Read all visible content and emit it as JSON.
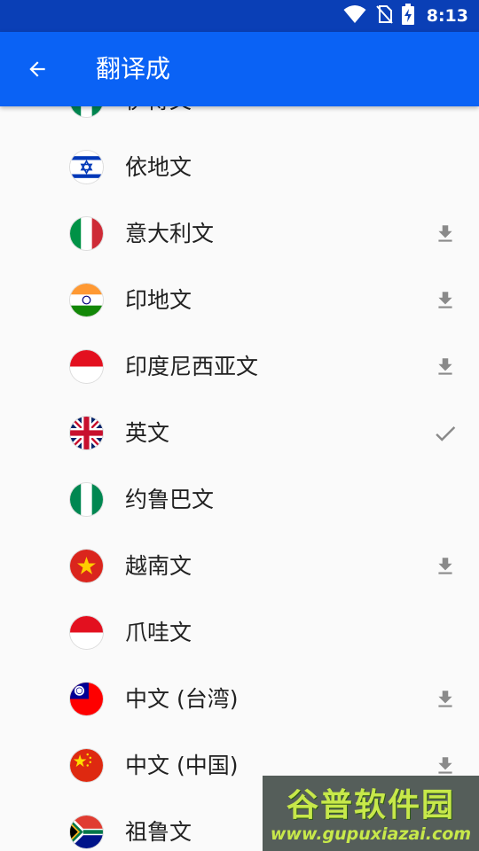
{
  "status_bar": {
    "time": "8:13",
    "icons": [
      "wifi-icon",
      "no-sim-icon",
      "battery-charging-icon"
    ]
  },
  "app_bar": {
    "back_icon": "arrow-back-icon",
    "title": "翻译成"
  },
  "colors": {
    "status_bar": "#0a3fb6",
    "app_bar": "#0a62f5",
    "text": "#212121",
    "icon_gray": "#8a8a8a"
  },
  "languages": [
    {
      "label": "伊博文",
      "flag": "nigeria",
      "action": "none"
    },
    {
      "label": "依地文",
      "flag": "israel",
      "action": "none"
    },
    {
      "label": "意大利文",
      "flag": "italy",
      "action": "download"
    },
    {
      "label": "印地文",
      "flag": "india",
      "action": "download"
    },
    {
      "label": "印度尼西亚文",
      "flag": "indonesia",
      "action": "download"
    },
    {
      "label": "英文",
      "flag": "uk",
      "action": "selected"
    },
    {
      "label": "约鲁巴文",
      "flag": "nigeria",
      "action": "none"
    },
    {
      "label": "越南文",
      "flag": "vietnam",
      "action": "download"
    },
    {
      "label": "爪哇文",
      "flag": "indonesia",
      "action": "none"
    },
    {
      "label": "中文 (台湾)",
      "flag": "taiwan",
      "action": "download"
    },
    {
      "label": "中文 (中国)",
      "flag": "china",
      "action": "download"
    },
    {
      "label": "祖鲁文",
      "flag": "south-africa",
      "action": "none"
    }
  ],
  "watermark": {
    "title": "谷普软件园",
    "url": "www.gupuxiazai.com"
  }
}
